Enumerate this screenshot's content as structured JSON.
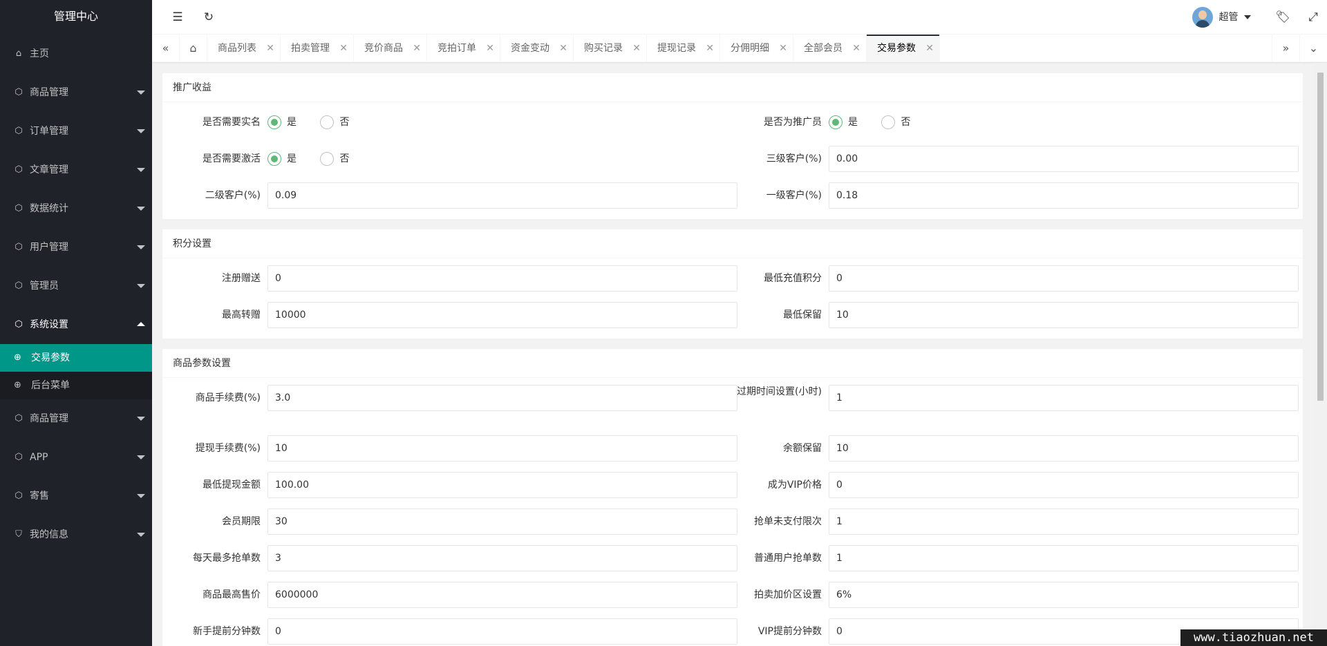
{
  "app_title": "管理中心",
  "sidebar": {
    "home": {
      "label": "主页",
      "icon": "home-icon"
    },
    "items": [
      {
        "label": "商品管理",
        "icon": "cube-icon"
      },
      {
        "label": "订单管理",
        "icon": "cube-icon"
      },
      {
        "label": "文章管理",
        "icon": "cube-icon"
      },
      {
        "label": "数据统计",
        "icon": "cube-icon"
      },
      {
        "label": "用户管理",
        "icon": "cube-icon"
      },
      {
        "label": "管理员",
        "icon": "cube-icon"
      },
      {
        "label": "系统设置",
        "icon": "cube-icon",
        "expanded": true
      }
    ],
    "sub_items": [
      {
        "label": "交易参数",
        "active": true
      },
      {
        "label": "后台菜单",
        "active": false
      }
    ],
    "items_after": [
      {
        "label": "商品管理",
        "icon": "cube-icon"
      },
      {
        "label": "APP",
        "icon": "cube-icon"
      },
      {
        "label": "寄售",
        "icon": "cube-icon"
      },
      {
        "label": "我的信息",
        "icon": "shield-icon"
      }
    ]
  },
  "header": {
    "shrink_icon": "menu-shrink-icon",
    "refresh_icon": "refresh-icon",
    "user_name": "超管",
    "tag_icon": "tag-icon",
    "fullscreen_icon": "fullscreen-icon"
  },
  "tabs": {
    "items": [
      {
        "label": "商品列表"
      },
      {
        "label": "拍卖管理"
      },
      {
        "label": "竞价商品"
      },
      {
        "label": "竞拍订单"
      },
      {
        "label": "资金变动"
      },
      {
        "label": "购买记录"
      },
      {
        "label": "提现记录"
      },
      {
        "label": "分佣明细"
      },
      {
        "label": "全部会员"
      },
      {
        "label": "交易参数",
        "active": true
      }
    ],
    "close_glyph": "✕"
  },
  "sections": {
    "promo": {
      "title": "推广收益",
      "need_realname": {
        "label": "是否需要实名",
        "yes": "是",
        "no": "否",
        "selected": "是"
      },
      "is_promoter": {
        "label": "是否为推广员",
        "yes": "是",
        "no": "否",
        "selected": "是"
      },
      "need_activate": {
        "label": "是否需要激活",
        "yes": "是",
        "no": "否",
        "selected": "是"
      },
      "level3": {
        "label": "三级客户(%)",
        "value": "0.00"
      },
      "level2": {
        "label": "二级客户(%)",
        "value": "0.09"
      },
      "level1": {
        "label": "一级客户(%)",
        "value": "0.18"
      }
    },
    "points": {
      "title": "积分设置",
      "register_gift": {
        "label": "注册赠送",
        "value": "0"
      },
      "min_recharge": {
        "label": "最低充值积分",
        "value": "0"
      },
      "max_transfer": {
        "label": "最高转赠",
        "value": "10000"
      },
      "min_keep": {
        "label": "最低保留",
        "value": "10"
      }
    },
    "goods": {
      "title": "商品参数设置",
      "fee": {
        "label": "商品手续费(%)",
        "value": "3.0"
      },
      "expire": {
        "label": "过期时间设置(小时)",
        "value": "1"
      },
      "withdraw_fee": {
        "label": "提现手续费(%)",
        "value": "10"
      },
      "balance_keep": {
        "label": "余额保留",
        "value": "10"
      },
      "min_withdraw": {
        "label": "最低提现金额",
        "value": "100.00"
      },
      "vip_price": {
        "label": "成为VIP价格",
        "value": "0"
      },
      "member_period": {
        "label": "会员期限",
        "value": "30"
      },
      "unpaid_limit": {
        "label": "抢单未支付限次",
        "value": "1"
      },
      "daily_max": {
        "label": "每天最多抢单数",
        "value": "3"
      },
      "normal_user": {
        "label": "普通用户抢单数",
        "value": "1"
      },
      "max_price": {
        "label": "商品最高售价",
        "value": "6000000"
      },
      "markup": {
        "label": "拍卖加价区设置",
        "value": "6%"
      },
      "newbie_minutes": {
        "label": "新手提前分钟数",
        "value": "0"
      },
      "vip_minutes": {
        "label": "VIP提前分钟数",
        "value": "0"
      }
    }
  },
  "watermark": "www.tiaozhuan.net"
}
